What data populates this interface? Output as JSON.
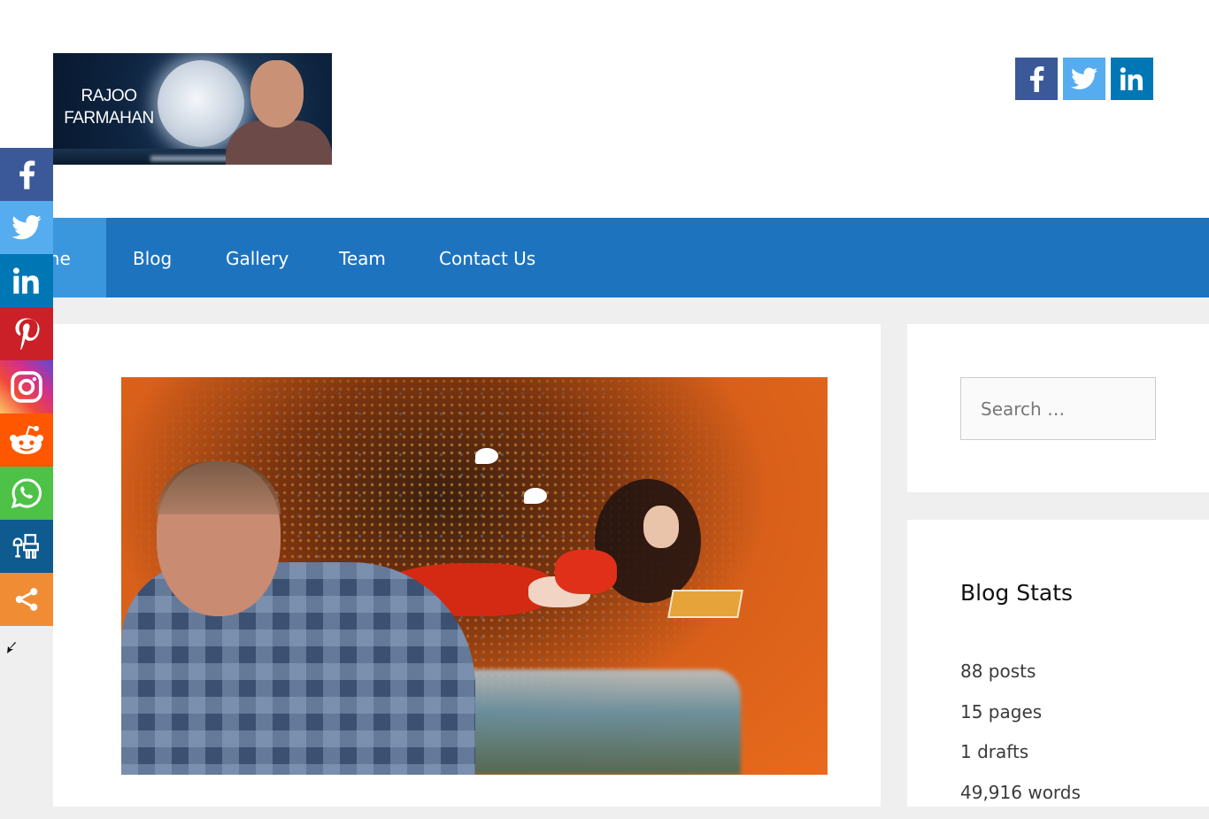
{
  "site": {
    "logo_text": [
      "RAJOO",
      "FARMAHAN"
    ],
    "logo_alt": "Rajoo Farmahan"
  },
  "header_social": [
    {
      "name": "facebook",
      "icon": "facebook-icon",
      "color": "#3b5998"
    },
    {
      "name": "twitter",
      "icon": "twitter-icon",
      "color": "#55acee"
    },
    {
      "name": "linkedin",
      "icon": "linkedin-icon",
      "color": "#0077b5"
    }
  ],
  "nav": {
    "items": [
      {
        "label": "Home",
        "visible_label": "me",
        "active": true
      },
      {
        "label": "Blog"
      },
      {
        "label": "Gallery"
      },
      {
        "label": "Team"
      },
      {
        "label": "Contact Us"
      }
    ],
    "bg_color": "#1e73be",
    "active_color": "#3a97dd"
  },
  "floating_share": [
    {
      "name": "facebook",
      "color": "#3b5998"
    },
    {
      "name": "twitter",
      "color": "#55acee"
    },
    {
      "name": "linkedin",
      "color": "#0077b5"
    },
    {
      "name": "pinterest",
      "color": "#cb2027"
    },
    {
      "name": "instagram",
      "color": "gradient"
    },
    {
      "name": "reddit",
      "color": "#ff5700"
    },
    {
      "name": "whatsapp",
      "color": "#4dc247"
    },
    {
      "name": "tumblr-like",
      "color": "#0f5a8f"
    },
    {
      "name": "more-share",
      "color": "#f08d34"
    }
  ],
  "featured_image": {
    "alt": "Portrait of a man in a checked shirt in front of a painting of a woman reading a book"
  },
  "sidebar": {
    "search": {
      "placeholder": "Search …",
      "value": ""
    },
    "blog_stats": {
      "title": "Blog Stats",
      "items": [
        "88 posts",
        "15 pages",
        "1 drafts",
        "49,916 words"
      ]
    }
  }
}
